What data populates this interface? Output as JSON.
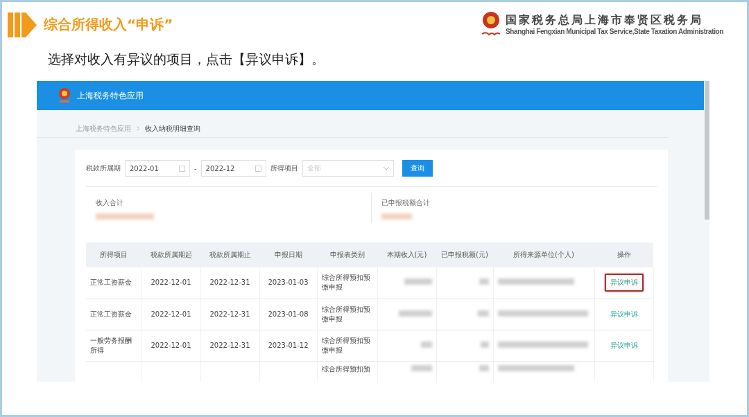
{
  "slide": {
    "title": "综合所得收入“申诉”",
    "org_name": "国家税务总局上海市奉贤区税务局",
    "org_name_en": "Shanghai Fengxian Municipal Tax Service,State Taxation Administration",
    "instruction": "选择对收入有异议的项目，点击【异议申诉】。"
  },
  "app": {
    "title": "上海税务特色应用",
    "breadcrumb": [
      {
        "label": "上海税务特色应用",
        "current": false
      },
      {
        "label": "收入纳税明细查询",
        "current": true
      }
    ],
    "filters": {
      "period_label": "税款所属期",
      "period_from": "2022-01",
      "separator": "-",
      "period_to": "2022-12",
      "item_label": "所得项目",
      "item_placeholder": "全部",
      "query_button": "查询"
    },
    "summary": [
      {
        "label": "收入合计"
      },
      {
        "label": "已申报税额合计"
      }
    ],
    "table": {
      "columns": [
        "所得项目",
        "税款所属期起",
        "税款所属期止",
        "申报日期",
        "申报表类别",
        "本期收入(元)",
        "已申报税额(元)",
        "所得来源单位(个人)",
        "操作"
      ],
      "rows": [
        {
          "item": "正常工资薪金",
          "start": "2022-12-01",
          "end": "2022-12-31",
          "date": "2023-01-03",
          "form_type": "综合所得预扣预缴申报",
          "action": "异议申诉",
          "highlighted": true
        },
        {
          "item": "正常工资薪金",
          "start": "2022-12-01",
          "end": "2022-12-31",
          "date": "2023-01-08",
          "form_type": "综合所得预扣预缴申报",
          "action": "异议申诉",
          "highlighted": false
        },
        {
          "item": "一般劳务报酬所得",
          "start": "2022-12-01",
          "end": "2022-12-31",
          "date": "2023-01-12",
          "form_type": "综合所得预扣预缴申报",
          "action": "异议申诉",
          "highlighted": false
        },
        {
          "form_type": "综合所得预扣预"
        }
      ]
    }
  }
}
